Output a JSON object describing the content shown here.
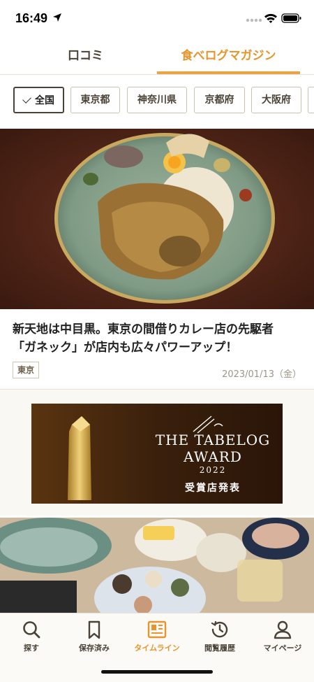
{
  "status": {
    "time": "16:49"
  },
  "tabs": [
    {
      "label": "口コミ",
      "active": false
    },
    {
      "label": "食べログマガジン",
      "active": true
    }
  ],
  "filters": [
    {
      "label": "全国",
      "selected": true
    },
    {
      "label": "東京都",
      "selected": false
    },
    {
      "label": "神奈川県",
      "selected": false
    },
    {
      "label": "京都府",
      "selected": false
    },
    {
      "label": "大阪府",
      "selected": false
    }
  ],
  "article": {
    "title_line1": "新天地は中目黒。東京の間借りカレー店の先駆者",
    "title_line2": "「ガネック」が店内も広々パワーアップ！",
    "tag": "東京",
    "date": "2023/01/13（金）"
  },
  "banner": {
    "title_line1": "THE TABELOG",
    "title_line2": "AWARD",
    "year": "2022",
    "subtitle": "受賞店発表"
  },
  "bottom_nav": [
    {
      "label": "探す",
      "icon": "search-icon",
      "active": false
    },
    {
      "label": "保存済み",
      "icon": "bookmark-icon",
      "active": false
    },
    {
      "label": "タイムライン",
      "icon": "timeline-icon",
      "active": true
    },
    {
      "label": "閲覧履歴",
      "icon": "history-icon",
      "active": false
    },
    {
      "label": "マイページ",
      "icon": "person-icon",
      "active": false
    }
  ],
  "colors": {
    "accent": "#e8942b",
    "text_dark": "#4a4236",
    "chip_border": "#cbc3b1"
  }
}
